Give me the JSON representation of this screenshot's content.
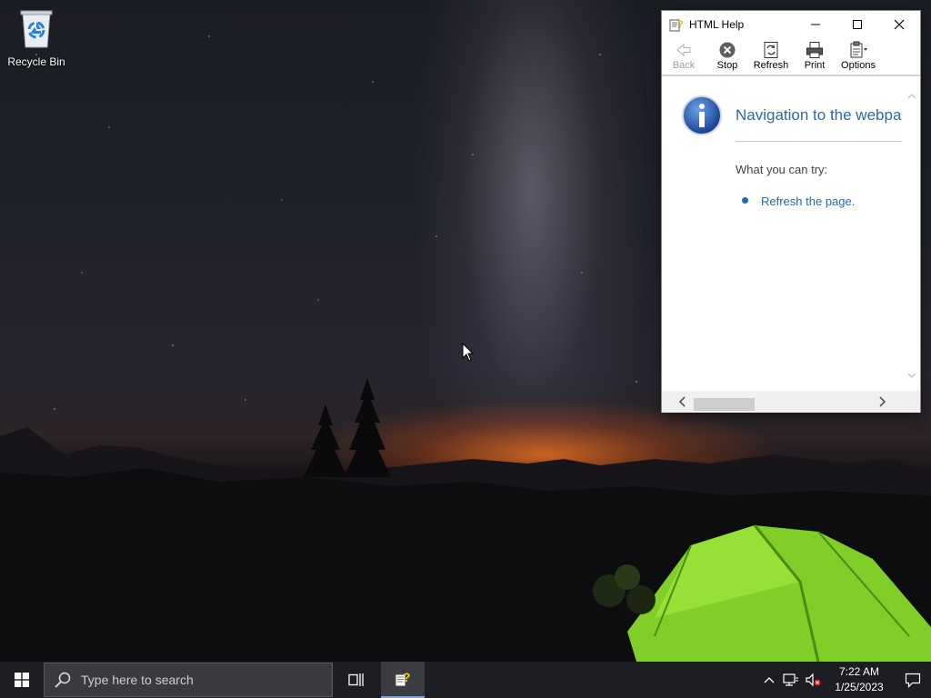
{
  "desktop": {
    "recycle_bin_label": "Recycle Bin"
  },
  "help_window": {
    "title": "HTML Help",
    "toolbar": {
      "back": "Back",
      "stop": "Stop",
      "refresh": "Refresh",
      "print": "Print",
      "options": "Options"
    },
    "error_title": "Navigation to the webpage was canceled",
    "try_label": "What you can try:",
    "refresh_link": "Refresh the page."
  },
  "taskbar": {
    "search_placeholder": "Type here to search",
    "time": "7:22 AM",
    "date": "1/25/2023"
  },
  "colors": {
    "link": "#2468b3",
    "heading": "#2c6ba0",
    "taskbar": "#1c1e23"
  }
}
